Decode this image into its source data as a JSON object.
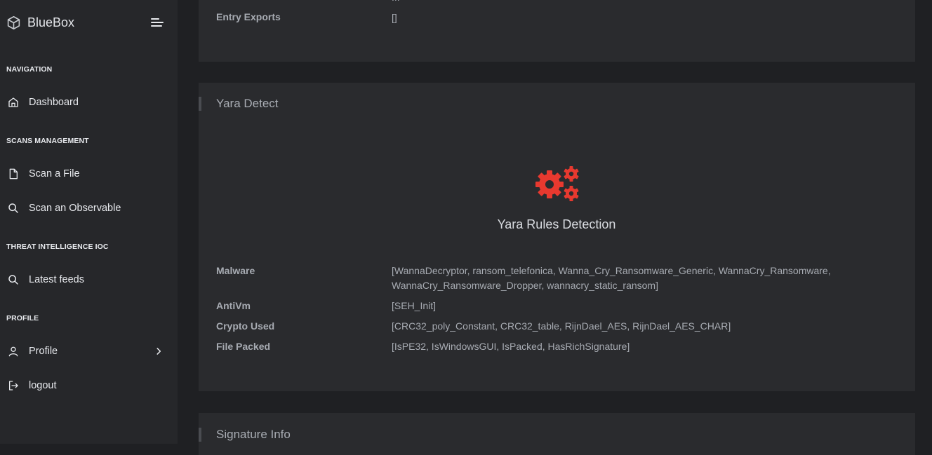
{
  "app": {
    "name": "BlueBox"
  },
  "sidebar": {
    "sections": [
      {
        "title": "NAVIGATION",
        "items": [
          {
            "label": "Dashboard",
            "icon": "home-icon"
          }
        ]
      },
      {
        "title": "SCANS MANAGEMENT",
        "items": [
          {
            "label": "Scan a File",
            "icon": "file-icon"
          },
          {
            "label": "Scan an Observable",
            "icon": "search-icon"
          }
        ]
      },
      {
        "title": "THREAT INTELLIGENCE IOC",
        "items": [
          {
            "label": "Latest feeds",
            "icon": "search-icon"
          }
        ]
      },
      {
        "title": "PROFILE",
        "items": [
          {
            "label": "Profile",
            "icon": "user-icon"
          },
          {
            "label": "logout",
            "icon": "logout-icon"
          }
        ]
      }
    ]
  },
  "top_card": {
    "cut_text": "...",
    "entry_exports_label": "Entry Exports",
    "entry_exports_value": "[]"
  },
  "yara": {
    "title": "Yara Detect",
    "detection_title": "Yara Rules Detection",
    "icon": "gears-icon",
    "icon_color": "#e8392f",
    "rows": [
      {
        "label": "Malware",
        "value": "[WannaDecryptor, ransom_telefonica, Wanna_Cry_Ransomware_Generic, WannaCry_Ransomware, WannaCry_Ransomware_Dropper, wannacry_static_ransom]"
      },
      {
        "label": "AntiVm",
        "value": "[SEH_Init]"
      },
      {
        "label": "Crypto Used",
        "value": "[CRC32_poly_Constant, CRC32_table, RijnDael_AES, RijnDael_AES_CHAR]"
      },
      {
        "label": "File Packed",
        "value": "[IsPE32, IsWindowsGUI, IsPacked, HasRichSignature]"
      }
    ]
  },
  "signature": {
    "title": "Signature Info"
  }
}
